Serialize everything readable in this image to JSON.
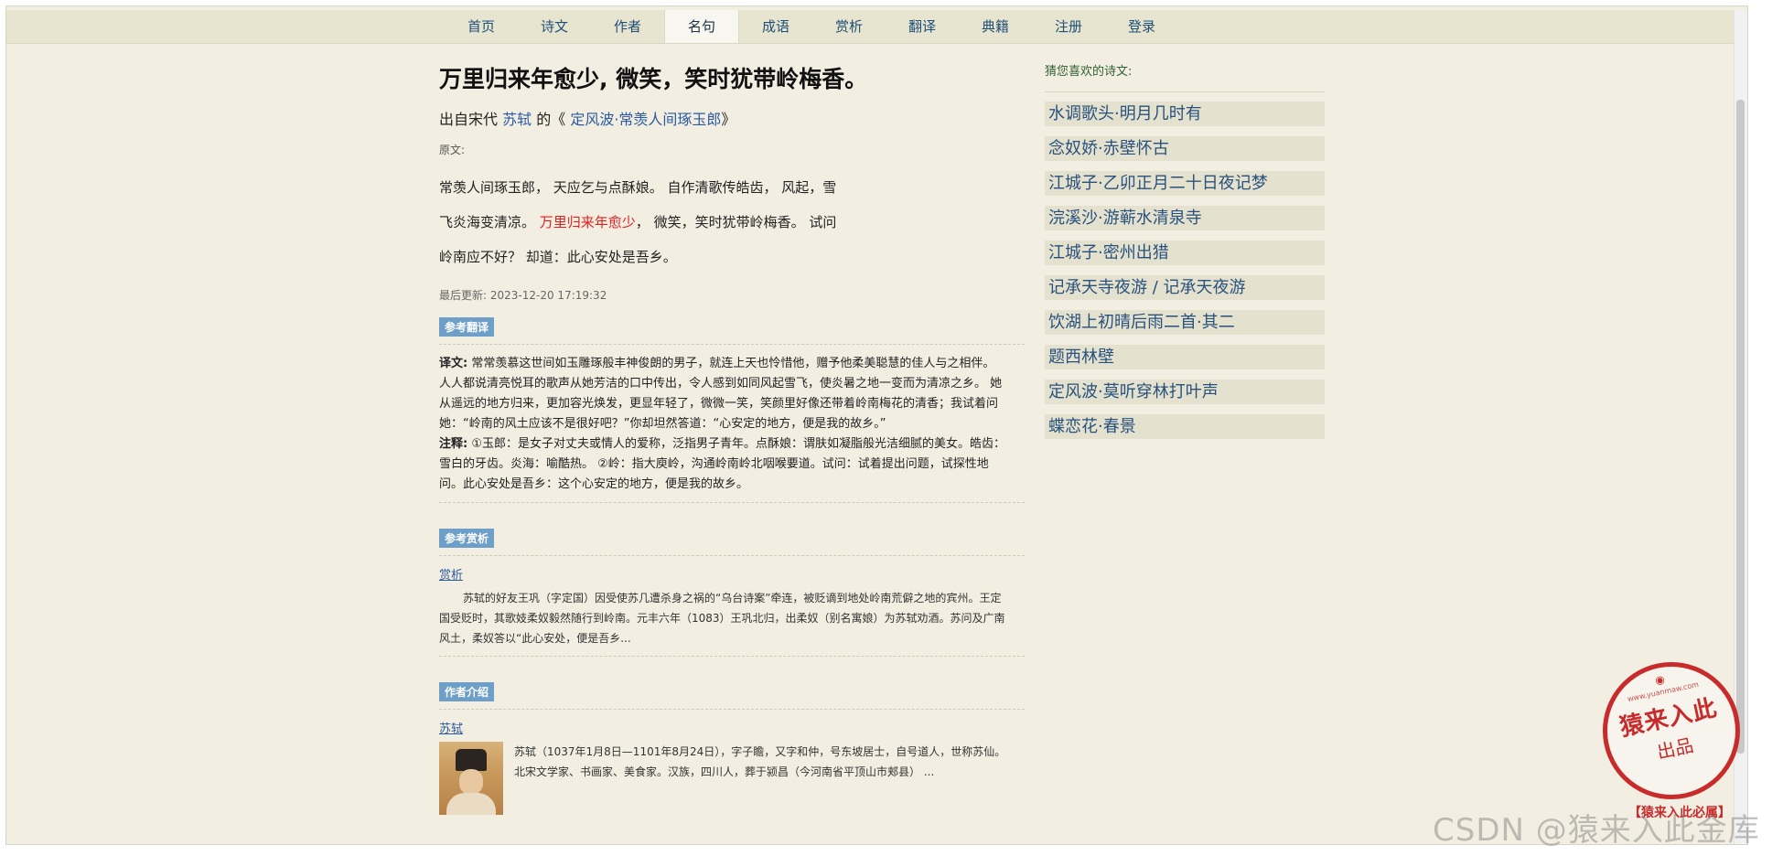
{
  "nav": {
    "items": [
      {
        "label": "首页"
      },
      {
        "label": "诗文"
      },
      {
        "label": "作者"
      },
      {
        "label": "名句",
        "active": true
      },
      {
        "label": "成语"
      },
      {
        "label": "赏析"
      },
      {
        "label": "翻译"
      },
      {
        "label": "典籍"
      },
      {
        "label": "注册"
      },
      {
        "label": "登录"
      }
    ]
  },
  "main": {
    "title": "万里归来年愈少, 微笑，笑时犹带岭梅香。",
    "source_prefix": "出自宋代",
    "author": "苏轼",
    "source_mid": "的《",
    "work": "定风波·常羡人间琢玉郎",
    "source_suffix": "》",
    "original_label": "原文:",
    "poem": {
      "part1": "常羡人间琢玉郎， 天应乞与点酥娘。 自作清歌传皓齿， 风起，雪飞炎海变清凉。 ",
      "highlight": "万里归来年愈少",
      "part2": "， 微笑，笑时犹带岭梅香。 试问岭南应不好？ 却道：此心安处是吾乡。"
    },
    "updated_label": "最后更新:",
    "updated_value": "2023-12-20 17:19:32",
    "translation": {
      "tag": "参考翻译",
      "yiwen_label": "译文:",
      "yiwen_text": " 常常羡慕这世间如玉雕琢般丰神俊朗的男子，就连上天也怜惜他，赠予他柔美聪慧的佳人与之相伴。人人都说清亮悦耳的歌声从她芳洁的口中传出，令人感到如同风起雪飞，使炎暑之地一变而为清凉之乡。 她从遥远的地方归来，更加容光焕发，更显年轻了，微微一笑，笑颜里好像还带着岭南梅花的清香；我试着问她：“岭南的风土应该不是很好吧？”你却坦然答道：“心安定的地方，便是我的故乡。”",
      "zhushi_label": "注释:",
      "zhushi_text": " ①玉郎：是女子对丈夫或情人的爱称，泛指男子青年。点酥娘：谓肤如凝脂般光洁细腻的美女。皓齿：雪白的牙齿。炎海：喻酷热。 ②岭：指大庾岭，沟通岭南岭北咽喉要道。试问：试着提出问题，试探性地问。此心安处是吾乡：这个心安定的地方，便是我的故乡。"
    },
    "appreciation": {
      "tag": "参考赏析",
      "title": "赏析",
      "text": "苏轼的好友王巩（字定国）因受使苏几遭杀身之祸的“乌台诗案”牵连，被贬谪到地处岭南荒僻之地的宾州。王定国受贬时，其歌妓柔奴毅然随行到岭南。元丰六年（1083）王巩北归，出柔奴（别名寓娘）为苏轼劝酒。苏问及广南风土，柔奴答以“此心安处，便是吾乡..."
    },
    "author_intro": {
      "tag": "作者介绍",
      "name": "苏轼",
      "text": "苏轼（1037年1月8日—1101年8月24日），字子瞻，又字和仲，号东坡居士，自号道人，世称苏仙。北宋文学家、书画家、美食家。汉族，四川人，葬于颍昌（今河南省平顶山市郏县） ..."
    }
  },
  "sidebar": {
    "header": "猜您喜欢的诗文:",
    "items": [
      "水调歌头·明月几时有",
      "念奴娇·赤壁怀古",
      "江城子·乙卯正月二十日夜记梦",
      "浣溪沙·游蕲水清泉寺",
      "江城子·密州出猎",
      "记承天寺夜游 / 记承天夜游",
      "饮湖上初晴后雨二首·其二",
      "题西林壁",
      "定风波·莫听穿林打叶声",
      "蝶恋花·春景"
    ]
  },
  "seal": {
    "url": "www.yuanmaw.com",
    "main": "猿来入此",
    "sub": "出品",
    "banner": "【猿来入此必属】"
  },
  "watermark": "CSDN @猿来入此金库",
  "colors": {
    "background": "#f2efe2",
    "nav": "#e7e4d0",
    "link": "#2c5aa0",
    "highlight": "#e02020",
    "tag": "#6e9fc9",
    "seal": "#c82b2b"
  }
}
